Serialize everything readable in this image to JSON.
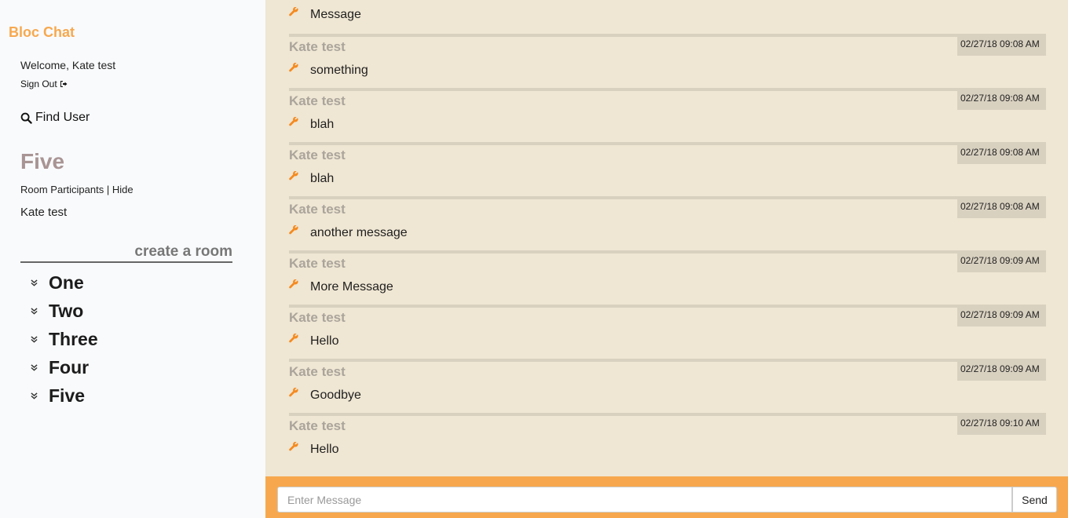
{
  "sidebar": {
    "brand": "Bloc Chat",
    "welcome": "Welcome, Kate test",
    "sign_out": "Sign Out",
    "find_user": "Find User",
    "current_room": "Five",
    "participants_label": "Room Participants",
    "participants_sep": " | ",
    "participants_hide": "Hide",
    "participants": [
      "Kate test"
    ],
    "create_room": "create a room",
    "rooms": [
      "One",
      "Two",
      "Three",
      "Four",
      "Five"
    ]
  },
  "messages": {
    "first_partial": {
      "content": "Message"
    },
    "items": [
      {
        "author": "Kate test",
        "time": "02/27/18 09:08 AM",
        "content": "something"
      },
      {
        "author": "Kate test",
        "time": "02/27/18 09:08 AM",
        "content": "blah"
      },
      {
        "author": "Kate test",
        "time": "02/27/18 09:08 AM",
        "content": "blah"
      },
      {
        "author": "Kate test",
        "time": "02/27/18 09:08 AM",
        "content": "another message"
      },
      {
        "author": "Kate test",
        "time": "02/27/18 09:09 AM",
        "content": "More Message"
      },
      {
        "author": "Kate test",
        "time": "02/27/18 09:09 AM",
        "content": "Hello"
      },
      {
        "author": "Kate test",
        "time": "02/27/18 09:09 AM",
        "content": "Goodbye"
      },
      {
        "author": "Kate test",
        "time": "02/27/18 09:10 AM",
        "content": "Hello"
      }
    ]
  },
  "composer": {
    "placeholder": "Enter Message",
    "value": "",
    "send_label": "Send"
  },
  "icons": {
    "sign_out": "sign-out-icon",
    "search": "search-icon",
    "room_toggle": "chevron-double-down-icon",
    "message_edit": "wrench-icon"
  },
  "colors": {
    "brand": "#f7a84e",
    "room_heading": "#a99494",
    "chat_background": "#efe6d3",
    "composer_bar": "#f7a84e",
    "wrench": "#f58a1f"
  }
}
